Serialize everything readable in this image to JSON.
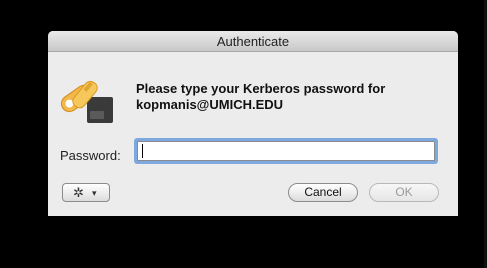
{
  "window": {
    "title": "Authenticate"
  },
  "dialog": {
    "message": "Please type your Kerberos password for kopmanis@UMICH.EDU",
    "icon": "keys-icon",
    "password_label": "Password:",
    "password_value": ""
  },
  "buttons": {
    "gear_icon": "gear-icon",
    "cancel_label": "Cancel",
    "ok_label": "OK"
  },
  "colors": {
    "focus_ring": "#7ea9de",
    "dialog_bg": "#ececec"
  }
}
